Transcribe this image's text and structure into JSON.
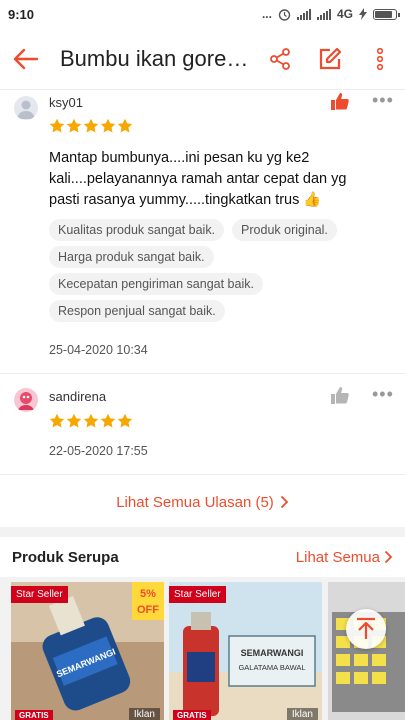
{
  "status_bar": {
    "time": "9:10",
    "dots": "...",
    "network": "4G"
  },
  "header": {
    "title": "Bumbu ikan goreng Semarwangi"
  },
  "reviews": [
    {
      "user": "ksy01",
      "rating": 5,
      "text": "Mantap bumbunya....ini pesan ku yg ke2 kali....pelayanannya ramah antar cepat dan yg pasti rasanya yummy.....tingkatkan trus 👍",
      "tags": [
        "Kualitas produk sangat baik.",
        "Produk original.",
        "Harga produk sangat baik.",
        "Kecepatan pengiriman sangat baik.",
        "Respon penjual sangat baik."
      ],
      "date": "25-04-2020 10:34",
      "liked": true
    },
    {
      "user": "sandirena",
      "rating": 5,
      "text": "",
      "tags": [],
      "date": "22-05-2020 17:55",
      "liked": false
    }
  ],
  "see_all_reviews": "Lihat Semua Ulasan (5)",
  "similar": {
    "title": "Produk Serupa",
    "see_all": "Lihat Semua",
    "products": [
      {
        "badge": "Star Seller",
        "discount_pct": "5%",
        "discount_label": "OFF",
        "ad": "Iklan",
        "free_ship": "GRATIS",
        "label": "SEMARWANGI"
      },
      {
        "badge": "Star Seller",
        "ad": "Iklan",
        "free_ship": "GRATIS",
        "sign_line1": "SEMARWANGI",
        "sign_line2": "GALATAMA BAWAL"
      },
      {
        "badge": "",
        "ad": ""
      }
    ]
  },
  "colors": {
    "accent": "#ee4d2d",
    "star": "#f6a700",
    "badge": "#d0011b"
  }
}
